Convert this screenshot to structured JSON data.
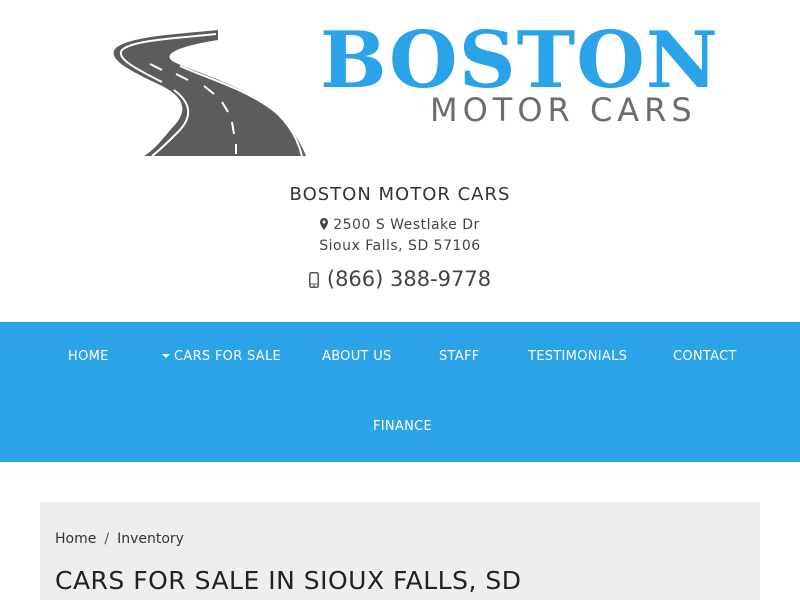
{
  "brand": {
    "logo_boston": "BOSTON",
    "logo_motor_cars": "MOTOR CARS",
    "dealer_name": "BOSTON MOTOR CARS",
    "address_line1": "2500 S Westlake Dr",
    "address_line2": "Sioux Falls, SD 57106",
    "phone": "(866) 388-9778",
    "colors": {
      "accent": "#2aa3e8",
      "logo_gray": "#6d6d6d",
      "road": "#5a5c5e"
    }
  },
  "nav": {
    "items": [
      {
        "label": "HOME"
      },
      {
        "label": "CARS FOR SALE",
        "has_dropdown": true
      },
      {
        "label": "ABOUT US"
      },
      {
        "label": "STAFF"
      },
      {
        "label": "TESTIMONIALS"
      },
      {
        "label": "CONTACT"
      },
      {
        "label": "FINANCE"
      }
    ]
  },
  "breadcrumb": {
    "home": "Home",
    "separator": "/",
    "current": "Inventory"
  },
  "page": {
    "title": "CARS FOR SALE IN SIOUX FALLS, SD",
    "background": "#eeeeee"
  },
  "icons": {
    "address": "map-pin-icon",
    "phone": "mobile-phone-icon",
    "dropdown": "caret-down-icon"
  }
}
